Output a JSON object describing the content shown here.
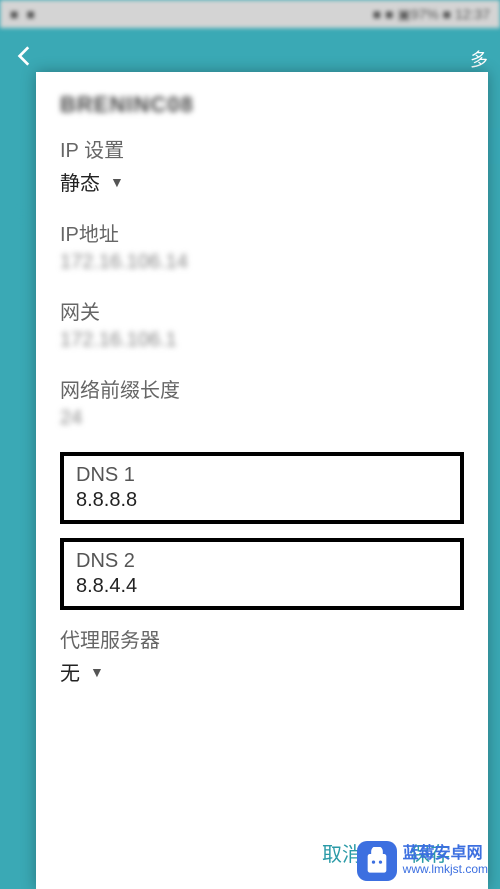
{
  "status": {
    "left1": "■",
    "left2": "■",
    "right": "■ ■ ▣97% ■ 12:37"
  },
  "appbar": {
    "more": "多"
  },
  "dialog": {
    "ssid": "BRENINC08",
    "ip_settings_label": "IP 设置",
    "ip_settings_value": "静态",
    "ip_label": "IP地址",
    "ip_value": "172.16.106.14",
    "gateway_label": "网关",
    "gateway_value": "172.16.106.1",
    "prefix_label": "网络前缀长度",
    "prefix_value": "24",
    "dns1_label": "DNS 1",
    "dns1_value": "8.8.8.8",
    "dns2_label": "DNS 2",
    "dns2_value": "8.8.4.4",
    "proxy_label": "代理服务器",
    "proxy_value": "无",
    "cancel": "取消",
    "save": "保存"
  },
  "watermark": {
    "cn": "蓝莓安卓网",
    "url": "www.lmkjst.com"
  }
}
